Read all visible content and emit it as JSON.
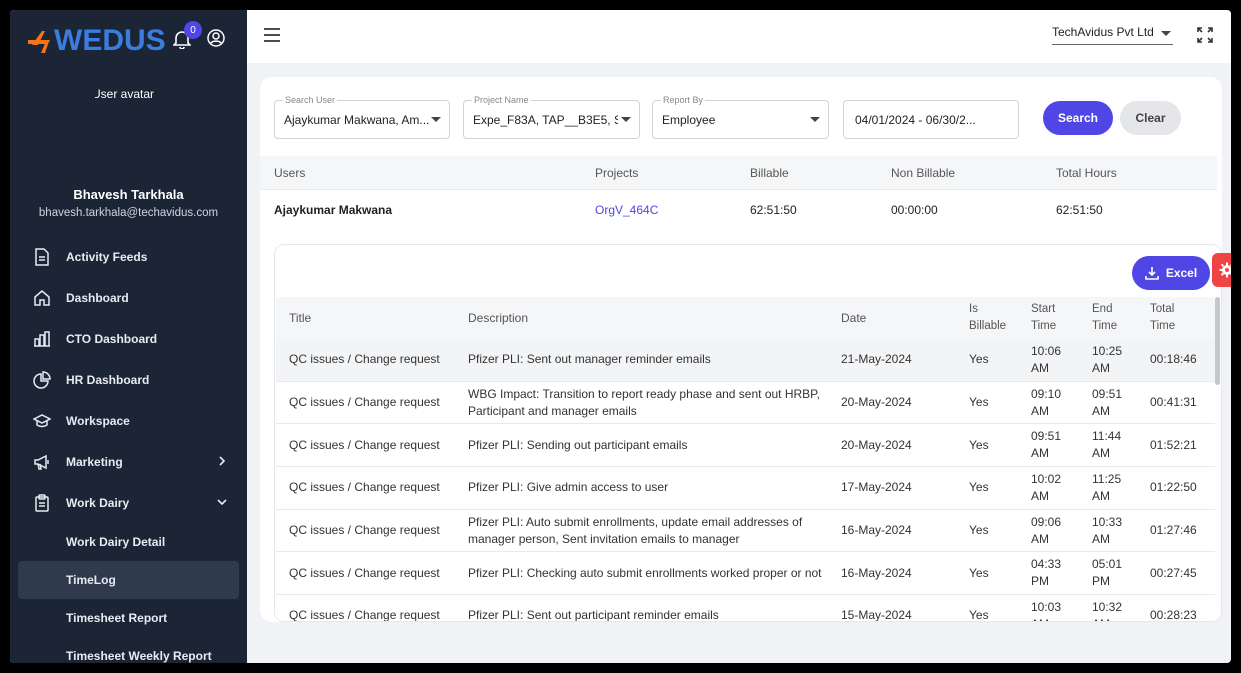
{
  "app": {
    "logo_text": "WEDUS",
    "notifications_count": "0",
    "avatar_alt": "User avatar",
    "user_name": "Bhavesh Tarkhala",
    "user_email": "bhavesh.tarkhala@techavidus.com"
  },
  "sidebar": {
    "items": [
      {
        "label": "Activity Feeds",
        "icon": "file-icon"
      },
      {
        "label": "Dashboard",
        "icon": "home-icon"
      },
      {
        "label": "CTO Dashboard",
        "icon": "bar-chart-icon"
      },
      {
        "label": "HR Dashboard",
        "icon": "pie-chart-icon"
      },
      {
        "label": "Workspace",
        "icon": "graduation-cap-icon"
      },
      {
        "label": "Marketing",
        "icon": "megaphone-icon"
      },
      {
        "label": "Work Dairy",
        "icon": "clipboard-icon"
      }
    ],
    "sub_items": [
      {
        "label": "Work Dairy Detail"
      },
      {
        "label": "TimeLog"
      },
      {
        "label": "Timesheet Report"
      },
      {
        "label": "Timesheet Weekly Report"
      }
    ]
  },
  "topbar": {
    "company": "TechAvidus Pvt Ltd"
  },
  "filters": {
    "search_user_label": "Search User",
    "search_user_value": "Ajaykumar Makwana, Am...",
    "project_label": "Project Name",
    "project_value": "Expe_F83A, TAP__B3E5, S...",
    "report_by_label": "Report By",
    "report_by_value": "Employee",
    "date_range": "04/01/2024 - 06/30/2...",
    "search_button": "Search",
    "clear_button": "Clear"
  },
  "summary": {
    "headers": {
      "users": "Users",
      "projects": "Projects",
      "billable": "Billable",
      "non_billable": "Non Billable",
      "total_hours": "Total Hours"
    },
    "row": {
      "user": "Ajaykumar Makwana",
      "project": "OrgV_464C",
      "billable": "62:51:50",
      "non_billable": "00:00:00",
      "total_hours": "62:51:50"
    }
  },
  "details": {
    "excel_button": "Excel",
    "headers": {
      "title": "Title",
      "description": "Description",
      "date": "Date",
      "is_billable_1": "Is",
      "is_billable_2": "Billable",
      "start_1": "Start",
      "start_2": "Time",
      "end_1": "End",
      "end_2": "Time",
      "total_1": "Total",
      "total_2": "Time"
    },
    "rows": [
      {
        "title": "QC issues / Change request",
        "desc": "Pfizer PLI: Sent out manager reminder emails",
        "desc2": "",
        "date": "21-May-2024",
        "billable": "Yes",
        "start": "10:06",
        "start_ampm": "AM",
        "end": "10:25",
        "end_ampm": "AM",
        "total": "00:18:46"
      },
      {
        "title": "QC issues / Change request",
        "desc": "WBG Impact: Transition to report ready phase and sent out HRBP,",
        "desc2": "Participant and manager emails",
        "date": "20-May-2024",
        "billable": "Yes",
        "start": "09:10",
        "start_ampm": "AM",
        "end": "09:51",
        "end_ampm": "AM",
        "total": "00:41:31"
      },
      {
        "title": "QC issues / Change request",
        "desc": "Pfizer PLI: Sending out participant emails",
        "desc2": "",
        "date": "20-May-2024",
        "billable": "Yes",
        "start": "09:51",
        "start_ampm": "AM",
        "end": "11:44",
        "end_ampm": "AM",
        "total": "01:52:21"
      },
      {
        "title": "QC issues / Change request",
        "desc": "Pfizer PLI: Give admin access to user",
        "desc2": "",
        "date": "17-May-2024",
        "billable": "Yes",
        "start": "10:02",
        "start_ampm": "AM",
        "end": "11:25",
        "end_ampm": "AM",
        "total": "01:22:50"
      },
      {
        "title": "QC issues / Change request",
        "desc": "Pfizer PLI: Auto submit enrollments, update email addresses of",
        "desc2": "manager person, Sent invitation emails to manager",
        "date": "16-May-2024",
        "billable": "Yes",
        "start": "09:06",
        "start_ampm": "AM",
        "end": "10:33",
        "end_ampm": "AM",
        "total": "01:27:46"
      },
      {
        "title": "QC issues / Change request",
        "desc": "Pfizer PLI: Checking auto submit enrollments worked proper or not",
        "desc2": "",
        "date": "16-May-2024",
        "billable": "Yes",
        "start": "04:33",
        "start_ampm": "PM",
        "end": "05:01",
        "end_ampm": "PM",
        "total": "00:27:45"
      },
      {
        "title": "QC issues / Change request",
        "desc": "Pfizer PLI: Sent out participant reminder emails",
        "desc2": "",
        "date": "15-May-2024",
        "billable": "Yes",
        "start": "10:03",
        "start_ampm": "AM",
        "end": "10:32",
        "end_ampm": "AM",
        "total": "00:28:23"
      }
    ]
  },
  "colors": {
    "sidebar_bg": "#1b2536",
    "accent": "#4f46e5",
    "logo_blue": "#3b7ddd",
    "logo_orange": "#f97316",
    "settings_red": "#ef4444"
  }
}
